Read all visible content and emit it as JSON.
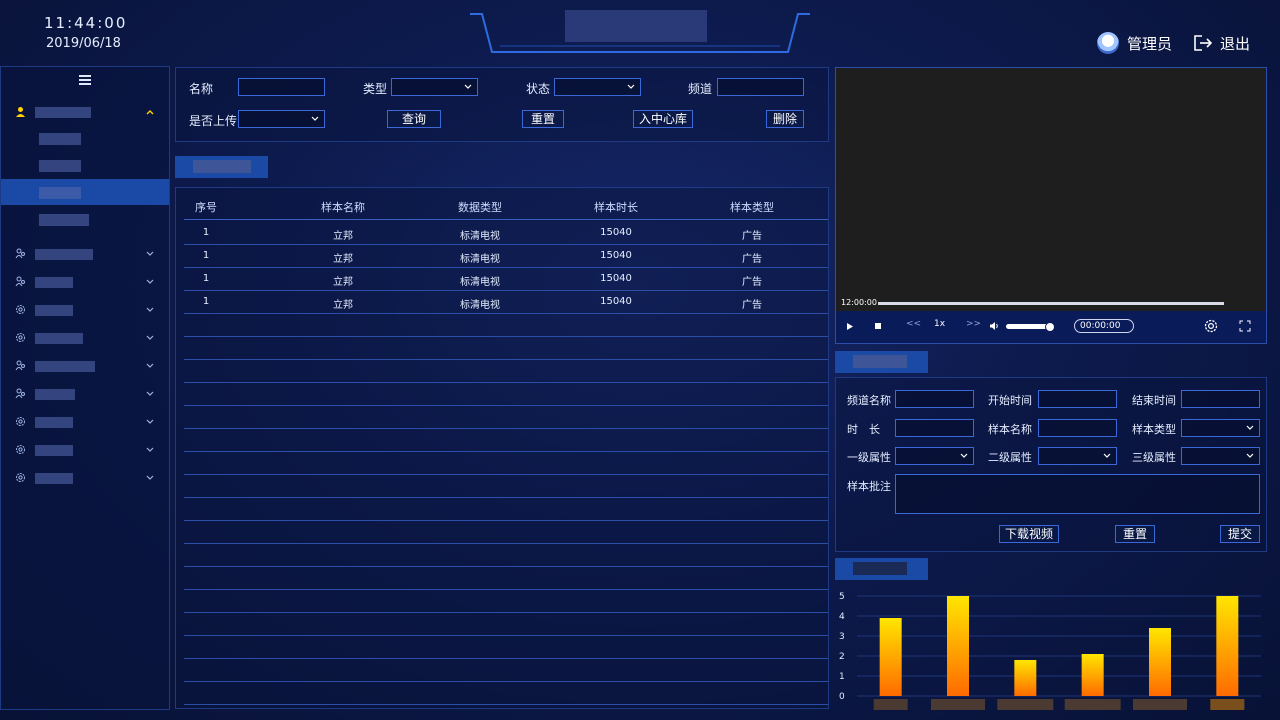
{
  "header": {
    "time": "11:44:00",
    "date": "2019/06/18",
    "user_label": "管理员",
    "logout_label": "退出"
  },
  "filters": {
    "name_label": "名称",
    "type_label": "类型",
    "status_label": "状态",
    "channel_label": "频道",
    "uploaded_label": "是否上传",
    "query_button": "查询",
    "reset_button": "重置",
    "to_center_button": "入中心库",
    "delete_button": "删除"
  },
  "table": {
    "columns": [
      "序号",
      "样本名称",
      "数据类型",
      "样本时长",
      "样本类型"
    ],
    "rows": [
      [
        "1",
        "立邦",
        "标清电视",
        "15040",
        "广告"
      ],
      [
        "1",
        "立邦",
        "标清电视",
        "15040",
        "广告"
      ],
      [
        "1",
        "立邦",
        "标清电视",
        "15040",
        "广告"
      ],
      [
        "1",
        "立邦",
        "标清电视",
        "15040",
        "广告"
      ]
    ]
  },
  "video": {
    "current_time": "12:00:00",
    "speed": "1x",
    "time_display": "00:00:00"
  },
  "form": {
    "channel_name_label": "频道名称",
    "start_time_label": "开始时间",
    "end_time_label": "结束时间",
    "duration_label": "时　长",
    "sample_name_label": "样本名称",
    "sample_type_label": "样本类型",
    "level1_label": "一级属性",
    "level2_label": "二级属性",
    "level3_label": "三级属性",
    "note_label": "样本批注",
    "download_button": "下载视频",
    "reset_button": "重置",
    "submit_button": "提交"
  },
  "chart_data": {
    "type": "bar",
    "categories": [
      "",
      "",
      "",
      "",
      "",
      ""
    ],
    "values": [
      3.9,
      5.0,
      1.8,
      2.1,
      3.4,
      5.0
    ],
    "title": "",
    "xlabel": "",
    "ylabel": "",
    "ylim": [
      0,
      5
    ],
    "yticks": [
      0,
      1,
      2,
      3,
      4,
      5
    ],
    "grid": true
  },
  "colors": {
    "accent": "#1b4aa6",
    "border": "#3a68d8",
    "bar_top": "#ffe600",
    "bar_bottom": "#ff6a00"
  }
}
